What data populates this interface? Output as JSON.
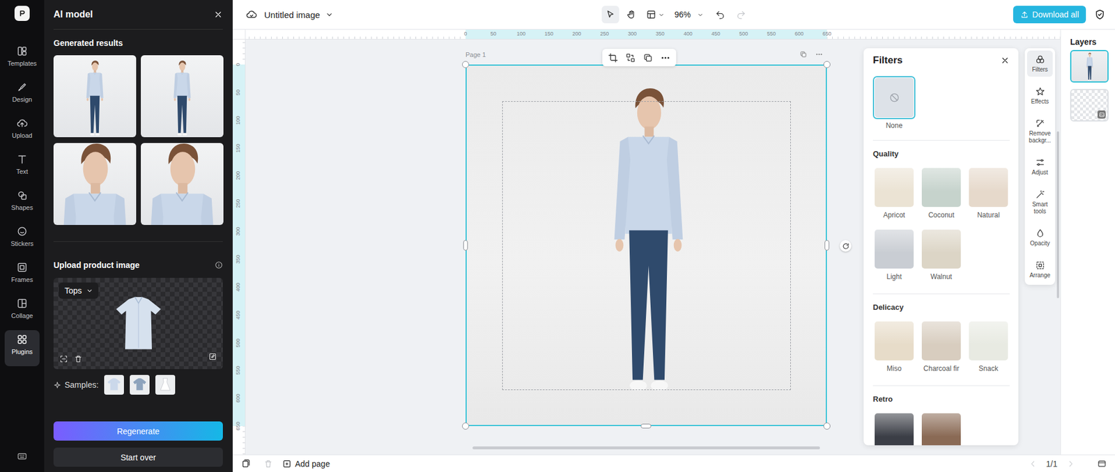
{
  "rail": {
    "items": [
      {
        "label": "Templates",
        "selected": false
      },
      {
        "label": "Design",
        "selected": false
      },
      {
        "label": "Upload",
        "selected": false
      },
      {
        "label": "Text",
        "selected": false
      },
      {
        "label": "Shapes",
        "selected": false
      },
      {
        "label": "Stickers",
        "selected": false
      },
      {
        "label": "Frames",
        "selected": false
      },
      {
        "label": "Collage",
        "selected": false
      },
      {
        "label": "Plugins",
        "selected": true
      }
    ]
  },
  "panel": {
    "title": "AI model",
    "results_heading": "Generated results",
    "results": [
      {
        "kind": "full"
      },
      {
        "kind": "full"
      },
      {
        "kind": "half"
      },
      {
        "kind": "half"
      }
    ],
    "upload_heading": "Upload product image",
    "category": "Tops",
    "samples_label": "Samples:",
    "samples": [
      {
        "kind": "shirt"
      },
      {
        "kind": "tee"
      },
      {
        "kind": "dress"
      }
    ],
    "buttons": [
      "Regenerate",
      "Start over"
    ]
  },
  "topbar": {
    "title": "Untitled image",
    "tools": [
      {
        "kind": "select",
        "selected": true
      },
      {
        "kind": "hand",
        "selected": false
      }
    ],
    "zoom": "96%",
    "history": {
      "undo_enabled": true,
      "redo_enabled": false
    },
    "download": "Download all"
  },
  "rulers": {
    "top": [
      "0",
      "50",
      "100",
      "150",
      "200",
      "250",
      "300",
      "350",
      "400",
      "450",
      "500",
      "550",
      "600",
      "650"
    ],
    "left": [
      "0",
      "50",
      "100",
      "150",
      "200",
      "250",
      "300",
      "350",
      "400",
      "450",
      "500",
      "550",
      "600",
      "650"
    ]
  },
  "page": {
    "label": "Page 1"
  },
  "filters": {
    "title": "Filters",
    "none": {
      "label": "None",
      "selected": true
    },
    "sections": [
      {
        "title": "Quality",
        "items": [
          {
            "label": "Apricot",
            "selected": false,
            "color": "#ebe3d4"
          },
          {
            "label": "Coconut",
            "selected": false,
            "color": "#c6d3cc"
          },
          {
            "label": "Natural",
            "selected": false,
            "color": "#e6d9cb"
          },
          {
            "label": "Light",
            "selected": false,
            "color": "#c9cdd3"
          },
          {
            "label": "Walnut",
            "selected": false,
            "color": "#dcd5c6"
          }
        ]
      },
      {
        "title": "Delicacy",
        "items": [
          {
            "label": "Miso",
            "selected": false,
            "color": "#e7dcc9"
          },
          {
            "label": "Charcoal fir",
            "selected": false,
            "color": "#d8cdbf"
          },
          {
            "label": "Snack",
            "selected": false,
            "color": "#e8eae2"
          }
        ]
      },
      {
        "title": "Retro",
        "items": [
          {
            "selected": false,
            "color": "#3b3e46"
          },
          {
            "selected": false,
            "color": "#8a6a55"
          }
        ]
      }
    ]
  },
  "tools": {
    "items": [
      {
        "label": "Filters",
        "selected": true
      },
      {
        "label": "Effects",
        "selected": false
      },
      {
        "label": "Remove backgr...",
        "selected": false
      },
      {
        "label": "Adjust",
        "selected": false
      },
      {
        "label": "Smart tools",
        "selected": false
      },
      {
        "label": "Opacity",
        "selected": false
      },
      {
        "label": "Arrange",
        "selected": false
      }
    ]
  },
  "layers": {
    "title": "Layers",
    "items": [
      {
        "kind": "photo",
        "selected": true
      },
      {
        "kind": "blank",
        "selected": false
      }
    ]
  },
  "bottom": {
    "delete_enabled": false,
    "add_page": "Add page",
    "page_count": "1/1"
  }
}
